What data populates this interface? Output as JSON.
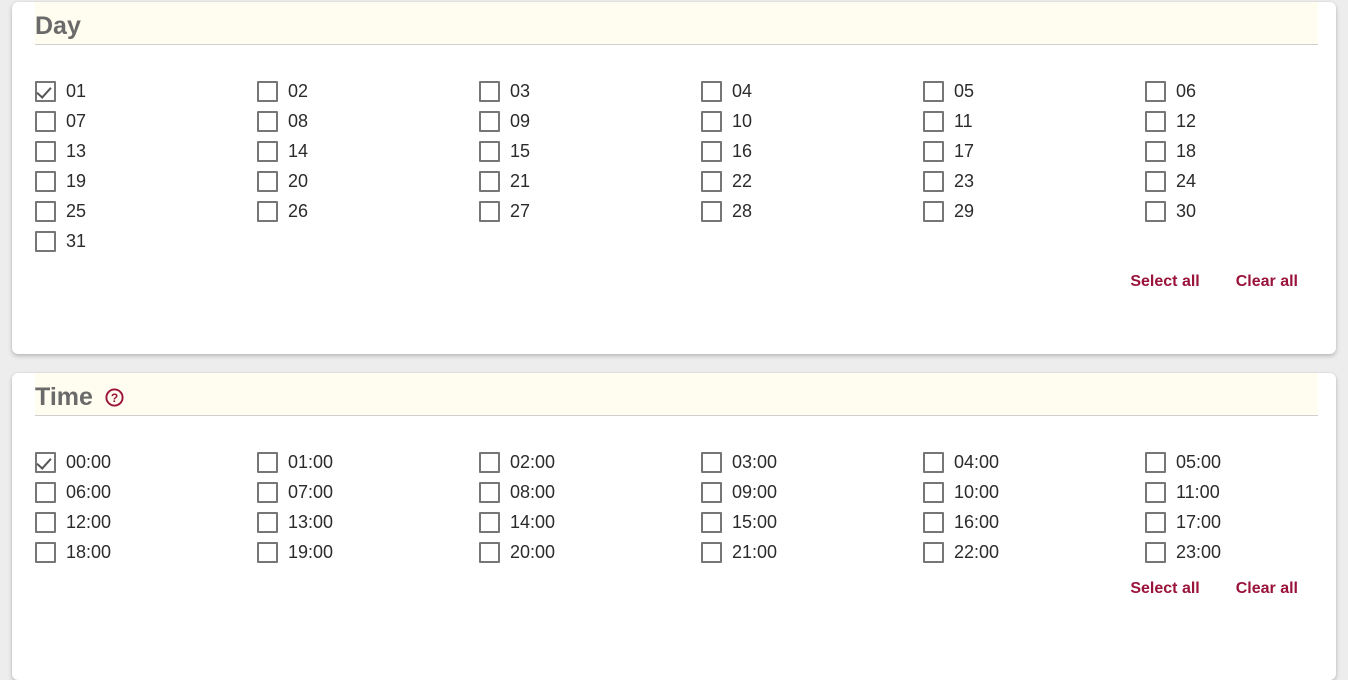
{
  "background_color": "#ededed",
  "accent_color": "#99133b",
  "header_band_color": "#fffdef",
  "panels": [
    {
      "id": "day",
      "title": "Day",
      "has_help_icon": false,
      "help_icon": "",
      "columns": [
        [
          {
            "label": "01",
            "checked": true
          },
          {
            "label": "07",
            "checked": false
          },
          {
            "label": "13",
            "checked": false
          },
          {
            "label": "19",
            "checked": false
          },
          {
            "label": "25",
            "checked": false
          },
          {
            "label": "31",
            "checked": false
          }
        ],
        [
          {
            "label": "02",
            "checked": false
          },
          {
            "label": "08",
            "checked": false
          },
          {
            "label": "14",
            "checked": false
          },
          {
            "label": "20",
            "checked": false
          },
          {
            "label": "26",
            "checked": false
          }
        ],
        [
          {
            "label": "03",
            "checked": false
          },
          {
            "label": "09",
            "checked": false
          },
          {
            "label": "15",
            "checked": false
          },
          {
            "label": "21",
            "checked": false
          },
          {
            "label": "27",
            "checked": false
          }
        ],
        [
          {
            "label": "04",
            "checked": false
          },
          {
            "label": "10",
            "checked": false
          },
          {
            "label": "16",
            "checked": false
          },
          {
            "label": "22",
            "checked": false
          },
          {
            "label": "28",
            "checked": false
          }
        ],
        [
          {
            "label": "05",
            "checked": false
          },
          {
            "label": "11",
            "checked": false
          },
          {
            "label": "17",
            "checked": false
          },
          {
            "label": "23",
            "checked": false
          },
          {
            "label": "29",
            "checked": false
          }
        ],
        [
          {
            "label": "06",
            "checked": false
          },
          {
            "label": "12",
            "checked": false
          },
          {
            "label": "18",
            "checked": false
          },
          {
            "label": "24",
            "checked": false
          },
          {
            "label": "30",
            "checked": false
          }
        ]
      ],
      "select_all_label": "Select all",
      "clear_all_label": "Clear all"
    },
    {
      "id": "time",
      "title": "Time",
      "has_help_icon": true,
      "help_icon": "help-circle-icon",
      "columns": [
        [
          {
            "label": "00:00",
            "checked": true
          },
          {
            "label": "06:00",
            "checked": false
          },
          {
            "label": "12:00",
            "checked": false
          },
          {
            "label": "18:00",
            "checked": false
          }
        ],
        [
          {
            "label": "01:00",
            "checked": false
          },
          {
            "label": "07:00",
            "checked": false
          },
          {
            "label": "13:00",
            "checked": false
          },
          {
            "label": "19:00",
            "checked": false
          }
        ],
        [
          {
            "label": "02:00",
            "checked": false
          },
          {
            "label": "08:00",
            "checked": false
          },
          {
            "label": "14:00",
            "checked": false
          },
          {
            "label": "20:00",
            "checked": false
          }
        ],
        [
          {
            "label": "03:00",
            "checked": false
          },
          {
            "label": "09:00",
            "checked": false
          },
          {
            "label": "15:00",
            "checked": false
          },
          {
            "label": "21:00",
            "checked": false
          }
        ],
        [
          {
            "label": "04:00",
            "checked": false
          },
          {
            "label": "10:00",
            "checked": false
          },
          {
            "label": "16:00",
            "checked": false
          },
          {
            "label": "22:00",
            "checked": false
          }
        ],
        [
          {
            "label": "05:00",
            "checked": false
          },
          {
            "label": "11:00",
            "checked": false
          },
          {
            "label": "17:00",
            "checked": false
          },
          {
            "label": "23:00",
            "checked": false
          }
        ]
      ],
      "select_all_label": "Select all",
      "clear_all_label": "Clear all"
    }
  ]
}
